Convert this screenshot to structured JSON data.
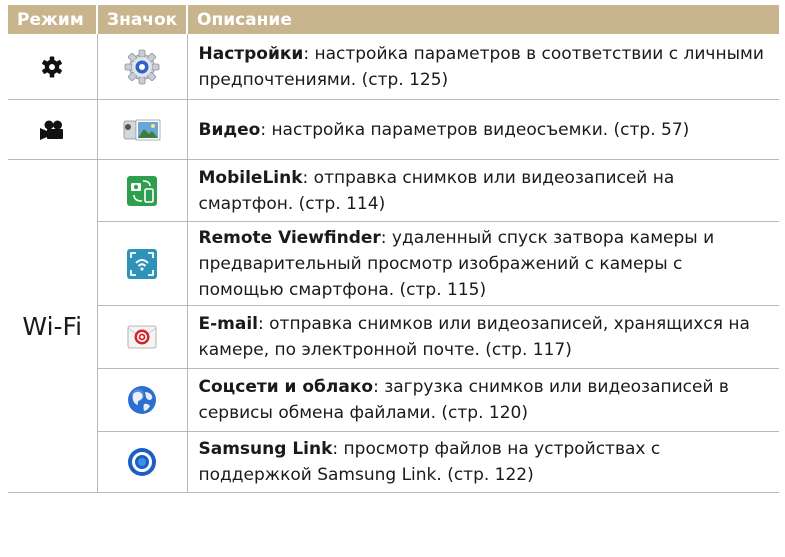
{
  "headers": {
    "mode": "Режим",
    "icon": "Значок",
    "description": "Описание"
  },
  "wifi_mode_label": "Wi-Fi",
  "rows": [
    {
      "icon": "settings-gear-icon",
      "mode_icon": "gear-mode-icon",
      "title": "Настройки",
      "text": ": настройка параметров в соответствии с личными предпочтениями. (стр. 125)"
    },
    {
      "icon": "video-icon",
      "mode_icon": "movie-camera-mode-icon",
      "title": "Видео",
      "text": ": настройка параметров видеосъемки. (стр. 57)"
    },
    {
      "icon": "mobilelink-icon",
      "title": "MobileLink",
      "text": ": отправка снимков или видеозаписей на смартфон. (стр. 114)"
    },
    {
      "icon": "remote-viewfinder-icon",
      "title": "Remote Viewfinder",
      "text": ": удаленный спуск затвора камеры и предварительный просмотр изображений с камеры с помощью смартфона. (стр. 115)"
    },
    {
      "icon": "email-icon",
      "title": "E-mail",
      "text": ": отправка снимков или видеозаписей, хранящихся на камере, по электронной почте. (стр. 117)"
    },
    {
      "icon": "globe-icon",
      "title": "Соцсети и облако",
      "text": ": загрузка снимков или видеозаписей в сервисы обмена файлами. (стр. 120)"
    },
    {
      "icon": "samsung-link-icon",
      "title": "Samsung Link",
      "text": ": просмотр файлов на устройствах с поддержкой Samsung Link. (стр. 122)"
    }
  ],
  "colors": {
    "header_bg": "#c8b58d",
    "grid": "#b8b8b8"
  }
}
